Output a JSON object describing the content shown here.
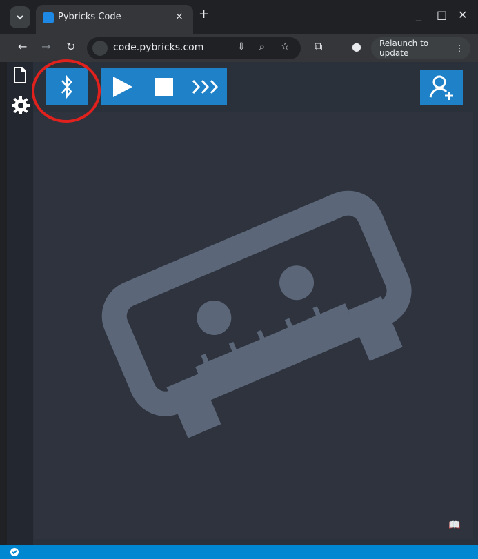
{
  "browser": {
    "tab_title": "Pybricks Code",
    "tab_close": "×",
    "new_tab": "+",
    "url": "code.pybricks.com",
    "relaunch_label": "Relaunch to update",
    "window_controls": [
      "_",
      "□",
      "✕"
    ]
  },
  "toolbar": {
    "buttons": [
      "bluetooth",
      "run",
      "stop",
      "repl"
    ],
    "account_icon": "person-add-icon"
  },
  "colors": {
    "accent": "#1f82c8",
    "status_bar": "#0087d1",
    "editor_bg": "#2e333d",
    "logo": "#5b6779",
    "highlight_ring": "#e0211d"
  },
  "icons": {
    "sidebar": [
      "file-icon",
      "settings-icon"
    ],
    "docs": "book-icon",
    "status": "check-circle-icon"
  }
}
